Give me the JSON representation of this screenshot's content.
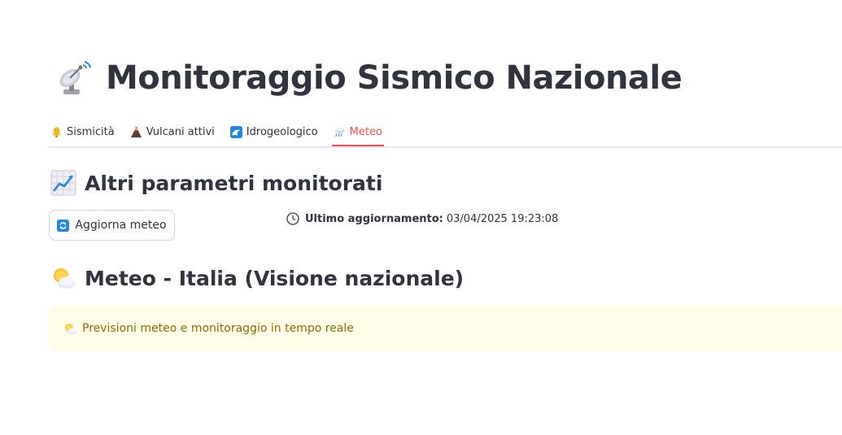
{
  "header": {
    "title": "Monitoraggio Sismico Nazionale",
    "icon": "satellite-antenna-icon"
  },
  "tabs": [
    {
      "label": "Sismicità",
      "icon": "bell-icon",
      "active": false
    },
    {
      "label": "Vulcani attivi",
      "icon": "volcano-icon",
      "active": false
    },
    {
      "label": "Idrogeologico",
      "icon": "water-wave-icon",
      "active": false
    },
    {
      "label": "Meteo",
      "icon": "cloud-rain-icon",
      "active": true
    }
  ],
  "section_params": {
    "heading": "Altri parametri monitorati",
    "icon": "chart-increasing-icon"
  },
  "refresh": {
    "label": "Aggiorna meteo",
    "icon": "refresh-icon"
  },
  "update": {
    "label": "Ultimo aggiornamento:",
    "value": "03/04/2025 19:23:08",
    "icon": "clock-icon"
  },
  "section_meteo": {
    "heading": "Meteo - Italia (Visione nazionale)",
    "icon": "sun-behind-cloud-icon"
  },
  "info": {
    "text": "Previsioni meteo e monitoraggio in tempo reale",
    "icon": "sun-behind-cloud-icon"
  },
  "colors": {
    "accent": "#ff4b4b",
    "text": "#31333f",
    "info_bg": "#fffce7",
    "info_text": "#926c05"
  }
}
